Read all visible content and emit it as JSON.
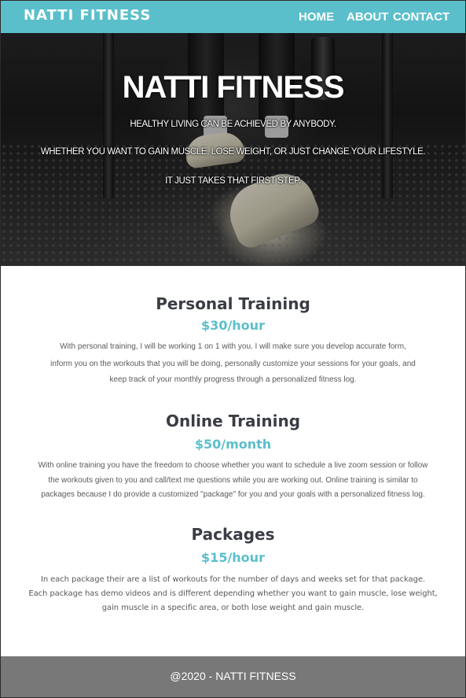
{
  "navbar": {
    "brand": "NATTI FITNESS",
    "links": [
      "HOME",
      "ABOUT",
      "CONTACT"
    ]
  },
  "hero": {
    "title": "NATTI FITNESS",
    "lines": [
      "HEALTHY LIVING CAN BE ACHIEVED BY ANYBODY.",
      "WHETHER YOU WANT TO GAIN MUSCLE, LOSE WEIGHT, OR JUST CHANGE YOUR LIFESTYLE.",
      "IT JUST TAKES THAT FIRST STEP."
    ]
  },
  "services": [
    {
      "title": "Personal Training",
      "price": "$30/hour",
      "lines": [
        "With personal training, I will be working 1 on 1 with you. I will make sure you develop accurate form,",
        "inform you on the workouts that you will be doing, personally customize your sessions for your goals, and",
        "keep track of your monthly progress through a personalized fitness log."
      ]
    },
    {
      "title": "Online Training",
      "price": "$50/month",
      "lines": [
        "With online training you have the freedom to choose whether you want to schedule a live zoom session or follow",
        "the workouts given to you and call/text me questions while you are working out. Online training is similar to",
        "packages because I do provide a customized \"package\" for you and your goals with a personalized fitness log."
      ]
    },
    {
      "title": "Packages",
      "price": "$15/hour",
      "lines": [
        "In each package their are a list of workouts for the number of days and weeks set for that package.",
        "Each package has demo videos and is different depending whether you want to gain muscle, lose weight,",
        "gain muscle in a specific area, or both lose weight and gain muscle."
      ]
    }
  ],
  "footer": {
    "text": "@2020 - NATTI FITNESS"
  },
  "colors": {
    "accent": "#5bbfcb",
    "footer": "#787878",
    "heading": "#3a3d44"
  }
}
